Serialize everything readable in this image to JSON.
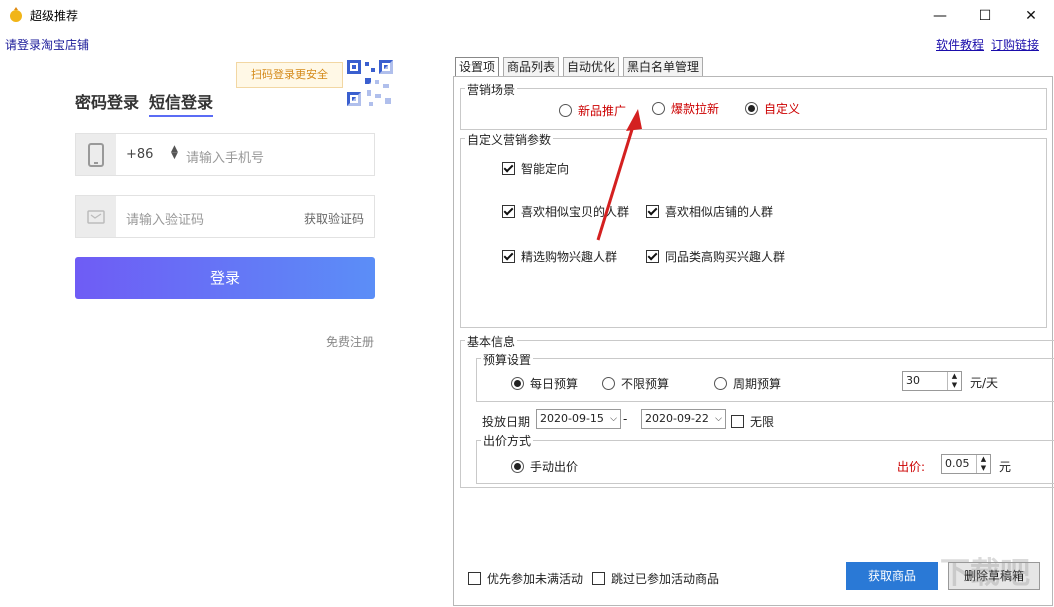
{
  "window": {
    "title": "超级推荐",
    "minimize": "—",
    "maximize": "☐",
    "close": "✕"
  },
  "header": {
    "login_link": "请登录淘宝店铺",
    "tutorial_link": "软件教程",
    "purchase_link": "订购链接"
  },
  "login": {
    "tab_password": "密码登录",
    "tab_sms": "短信登录",
    "scan_tip": "扫码登录更安全",
    "country_code": "+86",
    "phone_placeholder": "请输入手机号",
    "code_placeholder": "请输入验证码",
    "get_code": "获取验证码",
    "login_button": "登录",
    "register": "免费注册"
  },
  "tabs": [
    "设置项",
    "商品列表",
    "自动优化",
    "黑白名单管理"
  ],
  "scenario": {
    "label": "营销场景",
    "options": [
      "新品推广",
      "爆款拉新",
      "自定义"
    ],
    "selected": "自定义"
  },
  "custom_params": {
    "label": "自定义营销参数",
    "items": [
      {
        "label": "智能定向",
        "checked": true
      },
      {
        "label": "喜欢相似宝贝的人群",
        "checked": true
      },
      {
        "label": "喜欢相似店铺的人群",
        "checked": true
      },
      {
        "label": "精选购物兴趣人群",
        "checked": true
      },
      {
        "label": "同品类高购买兴趣人群",
        "checked": true
      }
    ]
  },
  "basic": {
    "label": "基本信息",
    "budget_label": "预算设置",
    "budget_options": [
      "每日预算",
      "不限预算",
      "周期预算"
    ],
    "budget_selected": "每日预算",
    "budget_value": "30",
    "budget_unit": "元/天",
    "date_label": "投放日期",
    "date_start": "2020-09-15",
    "date_sep": "-",
    "date_end": "2020-09-22",
    "unlimited": "无限",
    "bid_label": "出价方式",
    "bid_option": "手动出价",
    "bid_price_label": "出价:",
    "bid_value": "0.05",
    "bid_unit": "元"
  },
  "footer": {
    "prefer_activity": "优先参加未满活动",
    "skip_joined": "跳过已参加活动商品",
    "fetch_button": "获取商品",
    "delete_drafts_button": "删除草稿箱"
  },
  "watermark": "下载吧",
  "colors": {
    "accent_blue": "#2a79d6",
    "login_gradient_start": "#6f5cf5",
    "login_gradient_end": "#5b8ef7",
    "red_option": "#c00000",
    "arrow": "#d42020"
  }
}
